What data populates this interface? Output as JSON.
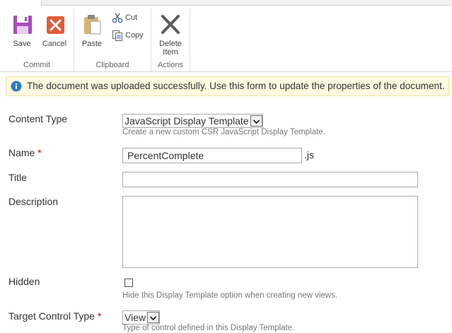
{
  "ribbon": {
    "commit": {
      "label": "Commit",
      "save": {
        "label": "Save",
        "icon": "save-icon",
        "color": "#a84bbb"
      },
      "cancel": {
        "label": "Cancel",
        "icon": "cancel-icon",
        "color": "#e05c3a"
      }
    },
    "clipboard": {
      "label": "Clipboard",
      "paste": {
        "label": "Paste",
        "icon": "paste-icon"
      },
      "cut": {
        "label": "Cut",
        "icon": "cut-icon"
      },
      "copy": {
        "label": "Copy",
        "icon": "copy-icon"
      }
    },
    "actions": {
      "label": "Actions",
      "delete": {
        "label_line1": "Delete",
        "label_line2": "Item",
        "icon": "delete-icon"
      }
    }
  },
  "status": {
    "icon": "info-icon",
    "message": "The document was uploaded successfully. Use this form to update the properties of the document.",
    "color": "#fff9df"
  },
  "form": {
    "content_type": {
      "label": "Content Type",
      "value": "JavaScript Display Template",
      "description": "Create a new custom CSR JavaScript Display Template."
    },
    "name": {
      "label": "Name",
      "required_marker": "*",
      "value": "PercentComplete",
      "suffix": ".js"
    },
    "title": {
      "label": "Title",
      "value": ""
    },
    "description": {
      "label": "Description",
      "value": ""
    },
    "hidden": {
      "label": "Hidden",
      "checked": false,
      "description": "Hide this Display Template option when creating new views."
    },
    "target_control_type": {
      "label": "Target Control Type",
      "required_marker": "*",
      "value": "View",
      "description": "Type of control defined in this Display Template."
    }
  }
}
